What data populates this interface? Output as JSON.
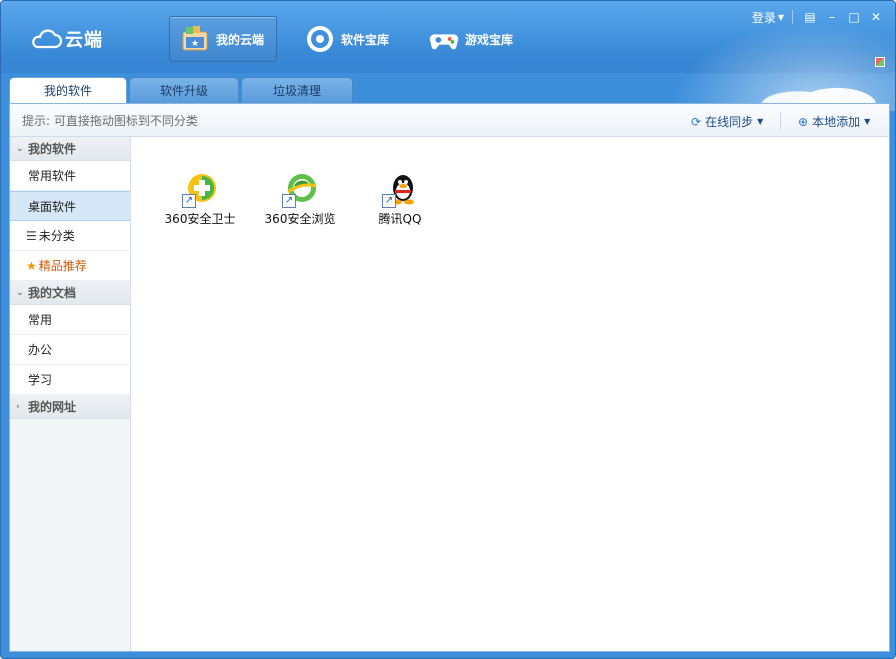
{
  "app": {
    "logo_text": "云端"
  },
  "nav": [
    {
      "label": "我的云端"
    },
    {
      "label": "软件宝库"
    },
    {
      "label": "游戏宝库"
    }
  ],
  "sysbar": {
    "login": "登录"
  },
  "tabs": [
    {
      "label": "我的软件"
    },
    {
      "label": "软件升级"
    },
    {
      "label": "垃圾清理"
    }
  ],
  "hintbar": {
    "hint": "提示: 可直接拖动图标到不同分类",
    "sync": "在线同步",
    "local_add": "本地添加"
  },
  "sidebar": {
    "groups": [
      {
        "title": "我的软件",
        "items": [
          "常用软件",
          "桌面软件",
          "未分类",
          "精品推荐"
        ]
      },
      {
        "title": "我的文档",
        "items": [
          "常用",
          "办公",
          "学习"
        ]
      },
      {
        "title": "我的网址",
        "items": []
      }
    ]
  },
  "apps": [
    {
      "label": "360安全卫士",
      "icon": "360-safe-icon"
    },
    {
      "label": "360安全浏览",
      "icon": "360-browser-icon"
    },
    {
      "label": "腾讯QQ",
      "icon": "qq-penguin-icon"
    }
  ],
  "colors": {
    "accent": "#3d8fdc",
    "featured": "#d15b06",
    "selected_bg": "#d6e8f8"
  }
}
